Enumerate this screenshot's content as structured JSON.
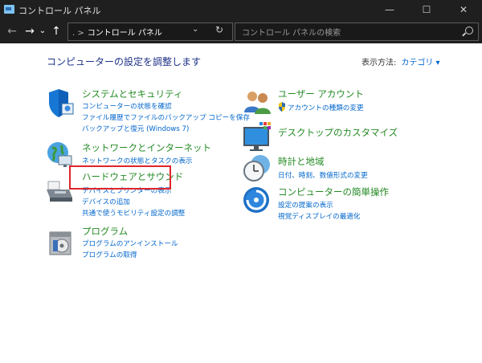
{
  "window": {
    "title": "コントロール パネル",
    "minimize": "—",
    "maximize": "☐",
    "close": "✕"
  },
  "toolbar": {
    "back": "←",
    "forward": "→",
    "recent": "⌄",
    "up": "↑"
  },
  "address": {
    "separator": ". >",
    "crumb": "コントロール パネル",
    "dropdown": "⌄",
    "refresh": "↻"
  },
  "search": {
    "placeholder": "コントロール パネルの検索"
  },
  "main": {
    "heading": "コンピューターの設定を調整します",
    "view_by_label": "表示方法:",
    "view_by_value": "カテゴリ ▾"
  },
  "categories": {
    "system": {
      "title": "システムとセキュリティ",
      "links": [
        "コンピューターの状態を確認",
        "ファイル履歴でファイルのバックアップ コピーを保存",
        "バックアップと復元 (Windows 7)"
      ]
    },
    "network": {
      "title": "ネットワークとインターネット",
      "links": [
        "ネットワークの状態とタスクの表示"
      ]
    },
    "hardware": {
      "title": "ハードウェアとサウンド",
      "links": [
        "デバイスとプリンターの表示",
        "デバイスの追加",
        "共通で使うモビリティ設定の調整"
      ]
    },
    "programs": {
      "title": "プログラム",
      "links": [
        "プログラムのアンインストール",
        "プログラムの取得"
      ]
    },
    "user": {
      "title": "ユーザー アカウント",
      "links": [
        "アカウントの種類の変更"
      ]
    },
    "desktop": {
      "title": "デスクトップのカスタマイズ",
      "links": []
    },
    "clock": {
      "title": "時計と地域",
      "links": [
        "日付、時刻、数値形式の変更"
      ]
    },
    "access": {
      "title": "コンピューターの簡単操作",
      "links": [
        "設定の提案の表示",
        "視覚ディスプレイの最適化"
      ]
    }
  },
  "colors": {
    "category_title": "#248a24",
    "link": "#0066cc",
    "heading": "#1e3287",
    "highlight": "#e0242b"
  }
}
